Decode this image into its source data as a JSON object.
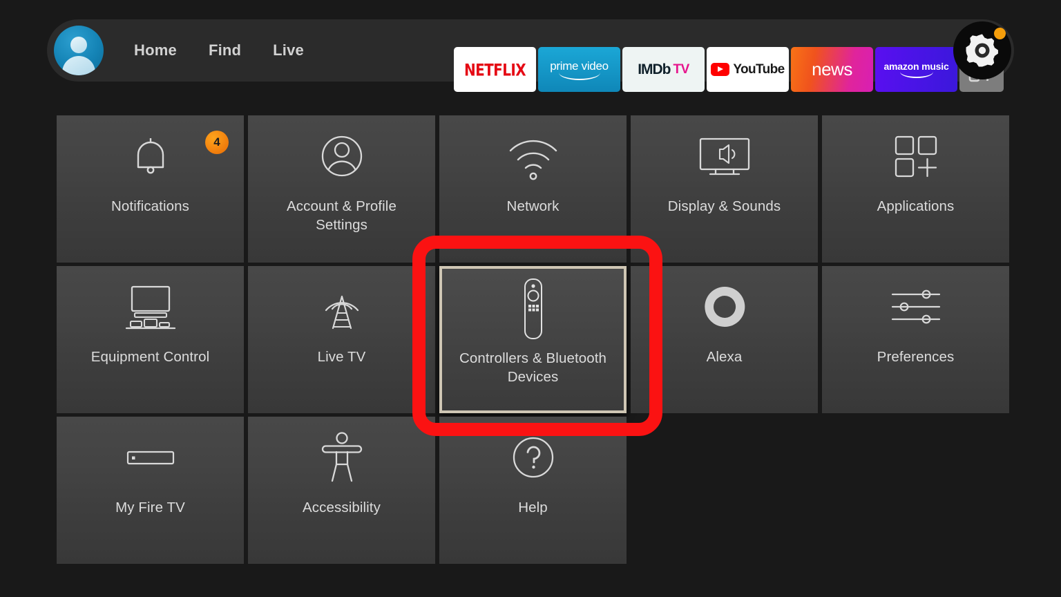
{
  "nav": {
    "avatar_label": "Profile avatar",
    "links": [
      {
        "label": "Home"
      },
      {
        "label": "Find"
      },
      {
        "label": "Live"
      }
    ],
    "apps": [
      {
        "name": "netflix",
        "label": "NETFLIX"
      },
      {
        "name": "prime-video",
        "label": "prime video"
      },
      {
        "name": "imdb-tv",
        "label": "IMDb",
        "label2": "TV"
      },
      {
        "name": "youtube",
        "label": "YouTube"
      },
      {
        "name": "news",
        "label": "news"
      },
      {
        "name": "amazon-music",
        "label": "amazon music"
      },
      {
        "name": "app-library",
        "label": ""
      }
    ],
    "settings_button": {
      "icon": "gear-icon",
      "has_notification_dot": true
    }
  },
  "settings_grid": {
    "tiles": [
      {
        "label": "Notifications",
        "icon": "bell-icon",
        "badge": "4"
      },
      {
        "label": "Account & Profile Settings",
        "icon": "person-circle-icon"
      },
      {
        "label": "Network",
        "icon": "wifi-icon"
      },
      {
        "label": "Display & Sounds",
        "icon": "tv-speaker-icon"
      },
      {
        "label": "Applications",
        "icon": "app-squares-plus-icon"
      },
      {
        "label": "Equipment Control",
        "icon": "tv-stand-icon"
      },
      {
        "label": "Live TV",
        "icon": "antenna-tower-icon"
      },
      {
        "label": "Controllers & Bluetooth Devices",
        "icon": "remote-control-icon",
        "selected": true
      },
      {
        "label": "Alexa",
        "icon": "alexa-ring-icon"
      },
      {
        "label": "Preferences",
        "icon": "sliders-icon"
      },
      {
        "label": "My Fire TV",
        "icon": "fire-tv-stick-icon"
      },
      {
        "label": "Accessibility",
        "icon": "accessibility-person-icon"
      },
      {
        "label": "Help",
        "icon": "question-circle-icon"
      }
    ]
  },
  "annotation": {
    "target": "Controllers & Bluetooth Devices",
    "color": "#fb1212"
  },
  "colors": {
    "background": "#191919",
    "tile": "#424242",
    "selected_border": "#cfc6b4",
    "badge": "#f59e0b",
    "accent_red": "#fb1212"
  }
}
